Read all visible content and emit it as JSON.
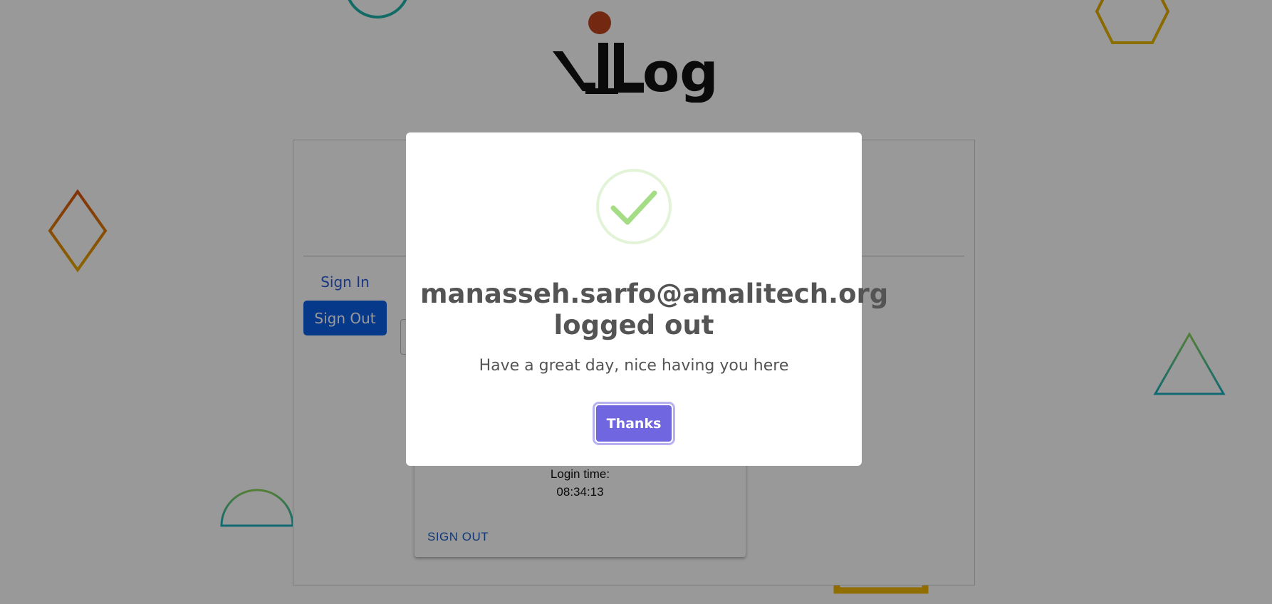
{
  "brand": {
    "logo_text": "VLLog"
  },
  "sidebar": {
    "signin_label": "Sign In",
    "signout_label": "Sign Out"
  },
  "card": {
    "login_time_label": "Login time:",
    "login_time_value": "08:34:13",
    "signout_link": "SIGN OUT"
  },
  "modal": {
    "title": "manasseh.sarfo@amalitech.org logged out",
    "text": "Have a great day, nice having you here",
    "confirm_label": "Thanks",
    "icon": "success-check-icon"
  },
  "colors": {
    "primary_button": "#0d5fe8",
    "confirm_button": "#7066e0",
    "success_green": "#a5dc86",
    "logo_dot": "#c0431d"
  }
}
